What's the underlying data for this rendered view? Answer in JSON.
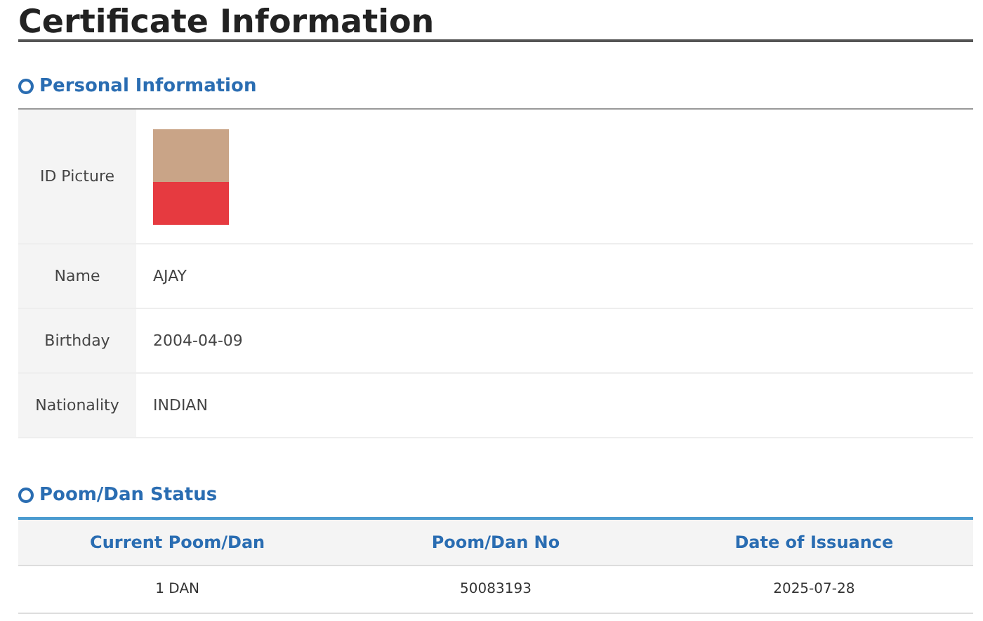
{
  "title": "Certificate Information",
  "personal": {
    "heading": "Personal Information",
    "photo_label": "ID Picture",
    "rows": [
      {
        "label": "Name",
        "value": "AJAY"
      },
      {
        "label": "Birthday",
        "value": "2004-04-09"
      },
      {
        "label": "Nationality",
        "value": "INDIAN"
      }
    ]
  },
  "status": {
    "heading": "Poom/Dan Status",
    "columns": [
      "Current Poom/Dan",
      "Poom/Dan No",
      "Date of Issuance"
    ],
    "rows": [
      [
        "1 DAN",
        "50083193",
        "2025-07-28"
      ]
    ]
  }
}
